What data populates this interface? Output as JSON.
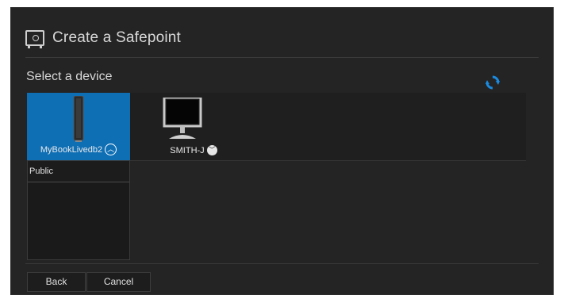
{
  "dialog": {
    "title": "Create a Safepoint",
    "title_icon": "safe-icon",
    "section_label": "Select a device",
    "refresh_icon": "refresh-icon",
    "accent_color": "#0f6fb5"
  },
  "devices": [
    {
      "name": "MyBookLivedb2",
      "icon": "nas-drive-icon",
      "selected": true,
      "expand_icon": "chevron-up-icon"
    },
    {
      "name": "SMITH-J",
      "icon": "monitor-icon",
      "selected": false,
      "expand_icon": "chevron-down-icon"
    }
  ],
  "shares": [
    {
      "label": "Public"
    }
  ],
  "buttons": {
    "back": "Back",
    "cancel": "Cancel"
  }
}
